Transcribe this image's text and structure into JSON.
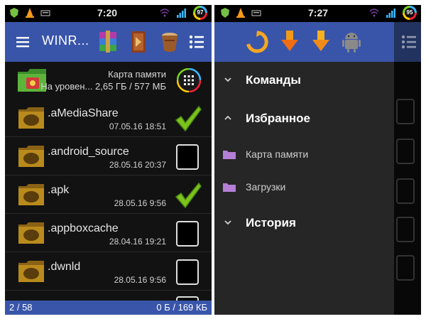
{
  "left": {
    "status": {
      "time": "7:20",
      "battery": "97"
    },
    "toolbar": {
      "app_name": "WINR..."
    },
    "root": {
      "title": "Карта памяти",
      "info": "На уровен... 2,65 ГБ / 577 МБ"
    },
    "files": [
      {
        "name": ".aMediaShare",
        "date": "07.05.16 18:51",
        "checked": true
      },
      {
        "name": ".android_source",
        "date": "28.05.16 20:37",
        "checked": false
      },
      {
        "name": ".apk",
        "date": "28.05.16 9:56",
        "checked": true
      },
      {
        "name": ".appboxcache",
        "date": "28.04.16 19:21",
        "checked": false
      },
      {
        "name": ".dwnld",
        "date": "28.05.16 9:56",
        "checked": false
      }
    ],
    "footer": {
      "selection": "2 / 58",
      "size": "0 Б / 169 КБ"
    }
  },
  "right": {
    "status": {
      "time": "7:27",
      "battery": "95"
    },
    "drawer": {
      "commands": "Команды",
      "favorites": "Избранное",
      "fav_items": [
        "Карта памяти",
        "Загрузки"
      ],
      "history": "История"
    }
  },
  "colors": {
    "accent": "#3955a9",
    "folder": "#b98a1c",
    "check": "#7cc41d",
    "fav_folder": "#b57fd6"
  }
}
